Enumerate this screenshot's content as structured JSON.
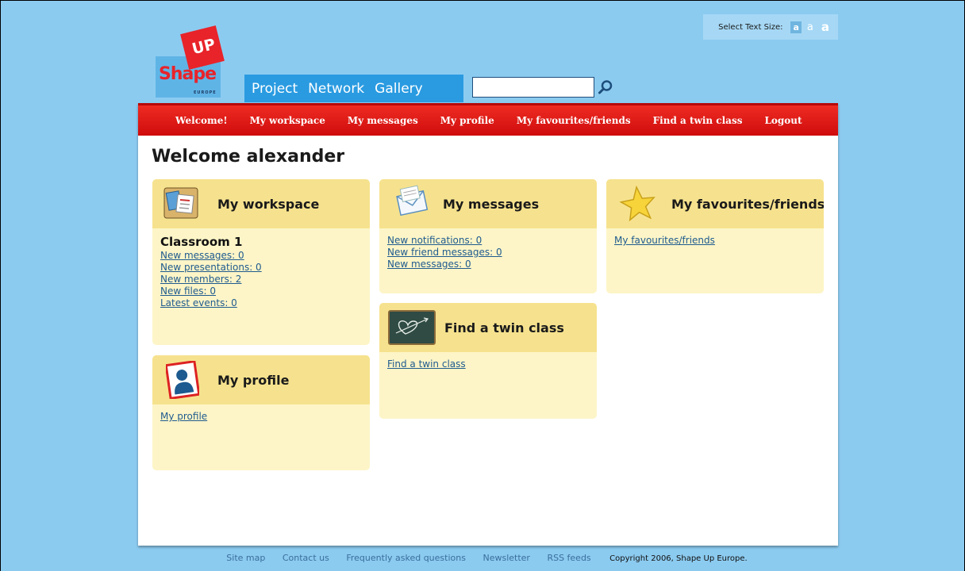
{
  "text_size": {
    "label": "Select Text Size:",
    "options": [
      "a",
      "a",
      "a"
    ]
  },
  "logo": {
    "up": "UP",
    "shape": "Shape",
    "europe": "EUROPE"
  },
  "topnav": [
    "Project",
    "Network",
    "Gallery"
  ],
  "search": {
    "value": "",
    "placeholder": ""
  },
  "rednav": [
    "Welcome!",
    "My workspace",
    "My messages",
    "My profile",
    "My favourites/friends",
    "Find a twin class",
    "Logout"
  ],
  "welcome": "Welcome alexander",
  "workspace": {
    "title": "My workspace",
    "subtitle": "Classroom 1",
    "links": [
      "New messages: 0",
      "New presentations: 0",
      "New members: 2",
      "New files: 0",
      "Latest events: 0"
    ]
  },
  "messages": {
    "title": "My messages",
    "links": [
      "New notifications: 0",
      "New friend messages: 0",
      "New messages: 0"
    ]
  },
  "favourites": {
    "title": "My favourites/friends",
    "links": [
      "My favourites/friends"
    ]
  },
  "twin": {
    "title": "Find a twin class",
    "links": [
      "Find a twin class"
    ]
  },
  "profile": {
    "title": "My profile",
    "links": [
      "My profile"
    ]
  },
  "footer": {
    "links": [
      "Site map",
      "Contact us",
      "Frequently asked questions",
      "Newsletter",
      "RSS feeds"
    ],
    "copyright": "Copyright 2006, Shape Up Europe."
  }
}
